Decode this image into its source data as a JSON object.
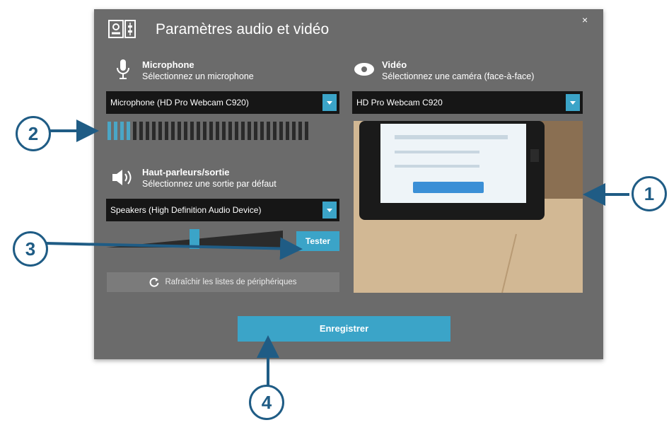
{
  "dialog": {
    "title": "Paramètres audio et vidéo",
    "close_icon": "×"
  },
  "microphone": {
    "icon": "microphone-icon",
    "heading": "Microphone",
    "subheading": "Sélectionnez un microphone",
    "selected": "Microphone (HD Pro Webcam C920)",
    "level_bars_total": 32,
    "level_bars_active": 4
  },
  "speakers": {
    "icon": "speaker-icon",
    "heading": "Haut-parleurs/sortie",
    "subheading": "Sélectionnez une sortie par défaut",
    "selected": "Speakers (High Definition Audio Device)",
    "volume_level": 0.5,
    "test_label": "Tester"
  },
  "refresh": {
    "icon": "refresh-icon",
    "label": "Rafraîchir les listes de périphériques"
  },
  "video": {
    "icon": "camera-icon",
    "heading": "Vidéo",
    "subheading": "Sélectionnez une caméra (face-à-face)",
    "selected": "HD Pro Webcam C920"
  },
  "save_label": "Enregistrer",
  "callouts": [
    "1",
    "2",
    "3",
    "4"
  ],
  "colors": {
    "accent": "#3ba4c8",
    "dialog_bg": "#6b6b6b",
    "callout": "#1f5c85"
  }
}
